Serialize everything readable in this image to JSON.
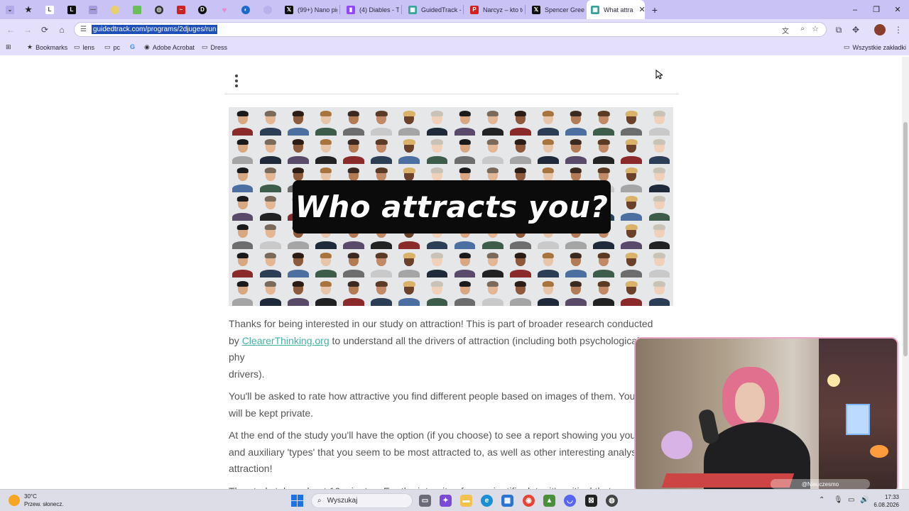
{
  "browser": {
    "tabs": [
      {
        "label": "",
        "icon": "more-tabs-icon",
        "pinned": true
      },
      {
        "label": "",
        "icon": "star-icon",
        "pinned": true
      },
      {
        "label": "",
        "icon": "l-site-icon",
        "pinned": true
      },
      {
        "label": "",
        "icon": "letter-l-icon",
        "pinned": true
      },
      {
        "label": "",
        "icon": "dash-site-icon",
        "pinned": true
      },
      {
        "label": "",
        "icon": "ball-icon",
        "pinned": true
      },
      {
        "label": "",
        "icon": "leaf-icon",
        "pinned": true
      },
      {
        "label": "",
        "icon": "chatgpt-icon",
        "pinned": true
      },
      {
        "label": "",
        "icon": "scribble-icon",
        "pinned": true
      },
      {
        "label": "",
        "icon": "circle-d-icon",
        "pinned": true
      },
      {
        "label": "",
        "icon": "heart-icon",
        "pinned": true
      },
      {
        "label": "",
        "icon": "steam-icon",
        "pinned": true
      },
      {
        "label": "",
        "icon": "blank-tab-icon",
        "pinned": true
      },
      {
        "label": "(99+) Nano pig",
        "icon": "x-twitter-icon"
      },
      {
        "label": "(4) Diables - Tw",
        "icon": "twitch-icon"
      },
      {
        "label": "GuidedTrack -",
        "icon": "guidedtrack-icon"
      },
      {
        "label": "Narcyz – kto to",
        "icon": "p-site-icon"
      },
      {
        "label": "Spencer Green",
        "icon": "x-twitter-icon"
      },
      {
        "label": "What attra",
        "icon": "guidedtrack-icon",
        "active": true
      }
    ],
    "new_tab": "+",
    "window_controls": {
      "minimize": "–",
      "maximize": "❐",
      "close": "✕"
    },
    "url": "guidedtrack.com/programs/2djuges/run",
    "bookmarks": [
      {
        "label": "Bookmarks",
        "icon": "star-icon"
      },
      {
        "label": "lens",
        "icon": "folder-icon"
      },
      {
        "label": "pc",
        "icon": "folder-icon"
      },
      {
        "label": "",
        "icon": "google-icon"
      },
      {
        "label": "Adobe Acrobat",
        "icon": "acrobat-icon"
      },
      {
        "label": "Dress",
        "icon": "folder-icon"
      }
    ],
    "all_bookmarks": "Wszystkie zakładki"
  },
  "page": {
    "hero_title": "Who attracts you?",
    "paragraphs": {
      "p1_a": "Thanks for being interested in our study on attraction! This is part of broader research conducted by ",
      "p1_link": "ClearerThinking.org",
      "p1_b": " to understand all the drivers of attraction (including both psychological and phy",
      "p1_c": "drivers).",
      "p2": "You'll be asked to rate how attractive you find different people based on images of them. Your resp",
      "p2_b": "will be kept private.",
      "p3": "At the end of the study you'll have the option (if you choose) to see a report showing you your prim",
      "p3_b": "and auxiliary 'types' that you seem to be most attracted to, as well as other interesting analyses ab",
      "p3_c": "attraction!",
      "p4": "The study takes about 10 minutes. For the integrity of our scientific data, it's critical that you give h"
    },
    "link_color": "#3fb3a6",
    "text_color": "#555555"
  },
  "webcam": {
    "handle": "@Nieuczesmo"
  },
  "taskbar": {
    "weather_temp": "30°C",
    "weather_desc": "Przew. słonecz.",
    "search_label": "Wyszukaj",
    "time": "17:33",
    "date": "6.08.2026"
  },
  "colors": {
    "tabstrip": "#c9c2f5",
    "toolbar": "#e4e0fb",
    "accent": "#1f4fb8"
  }
}
